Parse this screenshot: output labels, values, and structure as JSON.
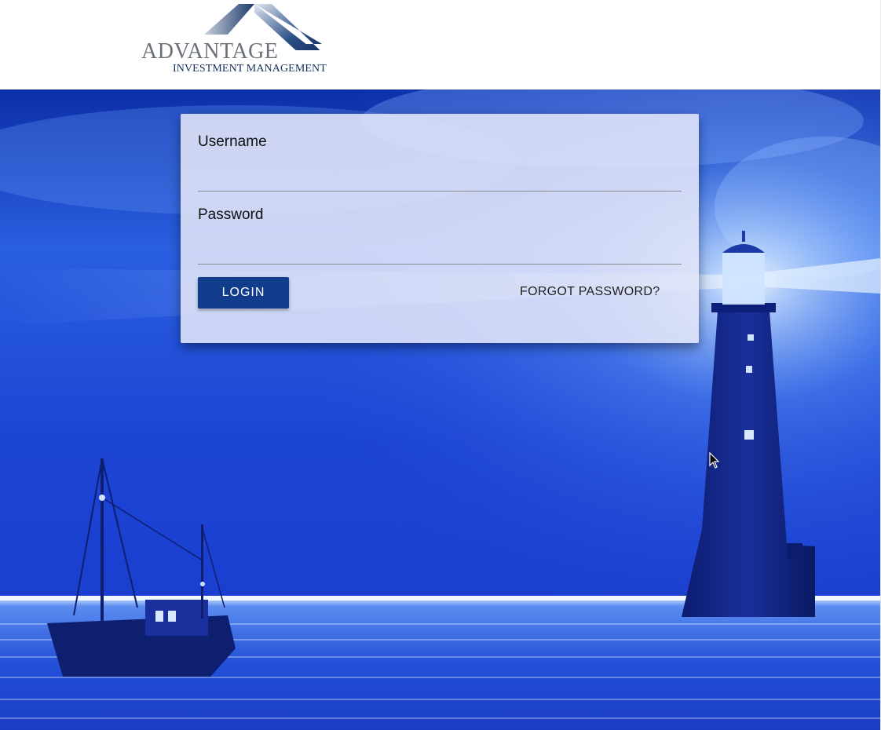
{
  "logo": {
    "main_text": "ADVANTAGE",
    "sub_text": "INVESTMENT MANAGEMENT"
  },
  "login_form": {
    "username_label": "Username",
    "username_value": "",
    "password_label": "Password",
    "password_value": "",
    "login_button": "LOGIN",
    "forgot_password_link": "FORGOT PASSWORD?"
  },
  "colors": {
    "brand_navy": "#123c8c",
    "logo_gray": "#6b7179",
    "sky_blue": "#1e44d8",
    "card_background": "#e4e6f8"
  },
  "background": {
    "scene": "lighthouse-and-boat-at-sea"
  }
}
